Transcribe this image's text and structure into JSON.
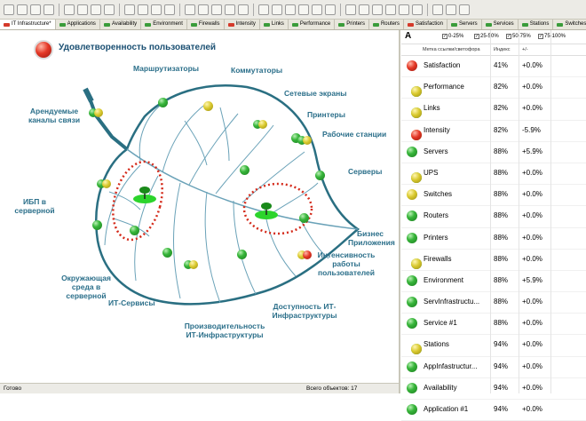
{
  "tabs": [
    {
      "label": "IT Infrastructure*",
      "active": true,
      "status": "red"
    },
    {
      "label": "Applications",
      "status": "green"
    },
    {
      "label": "Availability",
      "status": "green"
    },
    {
      "label": "Environment",
      "status": "green"
    },
    {
      "label": "Firewalls",
      "status": "green"
    },
    {
      "label": "Intensity",
      "status": "red"
    },
    {
      "label": "Links",
      "status": "green"
    },
    {
      "label": "Performance",
      "status": "green"
    },
    {
      "label": "Printers",
      "status": "green"
    },
    {
      "label": "Routers",
      "status": "green"
    },
    {
      "label": "Satisfaction",
      "status": "red"
    },
    {
      "label": "Servers",
      "status": "green"
    },
    {
      "label": "Services",
      "status": "green"
    },
    {
      "label": "Stations",
      "status": "green"
    },
    {
      "label": "Switches",
      "status": "green"
    },
    {
      "label": "UPS",
      "status": "green"
    }
  ],
  "map": {
    "title": "Удовлетворенность пользователей",
    "labels": {
      "routers": "Маршрутизаторы",
      "switches": "Коммутаторы",
      "firewalls": "Сетевые экраны",
      "printers": "Принтеры",
      "workstations": "Рабочие станции",
      "servers": "Серверы",
      "leased": "Арендуемые каналы связи",
      "ups": "ИБП в серверной",
      "environment": "Окружающая среда в серверной",
      "it_services": "ИТ-Сервисы",
      "performance": "Производительность ИТ-Инфраструктуры",
      "availability": "Доступность ИТ-Инфраструктуры",
      "intensity": "Интенсивность работы пользователей",
      "business_apps": "Бизнес Приложения"
    }
  },
  "statusbar": {
    "left": "Готово",
    "count": "Всего объектов: 17"
  },
  "panel": {
    "font_icon": "A",
    "filters": [
      "0-25%",
      "25-50%",
      "50-75%",
      "75-100%"
    ],
    "columns": {
      "name": "Метка ссылки/светофора",
      "index": "Индекс",
      "delta": "+/-"
    },
    "rows": [
      {
        "name": "Satisfaction",
        "index": "41%",
        "delta": "+0.0%",
        "status": "red"
      },
      {
        "name": "Performance",
        "index": "82%",
        "delta": "+0.0%",
        "status": "green-yellow"
      },
      {
        "name": "Links",
        "index": "82%",
        "delta": "+0.0%",
        "status": "green-yellow"
      },
      {
        "name": "Intensity",
        "index": "82%",
        "delta": "-5.9%",
        "status": "yellow-red"
      },
      {
        "name": "Servers",
        "index": "88%",
        "delta": "+5.9%",
        "status": "green"
      },
      {
        "name": "UPS",
        "index": "88%",
        "delta": "+0.0%",
        "status": "green-yellow"
      },
      {
        "name": "Switches",
        "index": "88%",
        "delta": "+0.0%",
        "status": "yellow"
      },
      {
        "name": "Routers",
        "index": "88%",
        "delta": "+0.0%",
        "status": "green"
      },
      {
        "name": "Printers",
        "index": "88%",
        "delta": "+0.0%",
        "status": "green"
      },
      {
        "name": "Firewalls",
        "index": "88%",
        "delta": "+0.0%",
        "status": "green-yellow"
      },
      {
        "name": "Environment",
        "index": "88%",
        "delta": "+5.9%",
        "status": "green"
      },
      {
        "name": "ServInfrastructu...",
        "index": "88%",
        "delta": "+0.0%",
        "status": "green"
      },
      {
        "name": "Service #1",
        "index": "88%",
        "delta": "+0.0%",
        "status": "green"
      },
      {
        "name": "Stations",
        "index": "94%",
        "delta": "+0.0%",
        "status": "green-yellow"
      },
      {
        "name": "AppInfastructur...",
        "index": "94%",
        "delta": "+0.0%",
        "status": "green"
      },
      {
        "name": "Availability",
        "index": "94%",
        "delta": "+0.0%",
        "status": "green"
      },
      {
        "name": "Application #1",
        "index": "94%",
        "delta": "+0.0%",
        "status": "green"
      }
    ]
  },
  "colors": {
    "label": "#2b6f8a",
    "leaf_outline": "#2a6f82",
    "leaf_vein": "#6aa2b8",
    "dotted_circle": "#d42a1a"
  }
}
